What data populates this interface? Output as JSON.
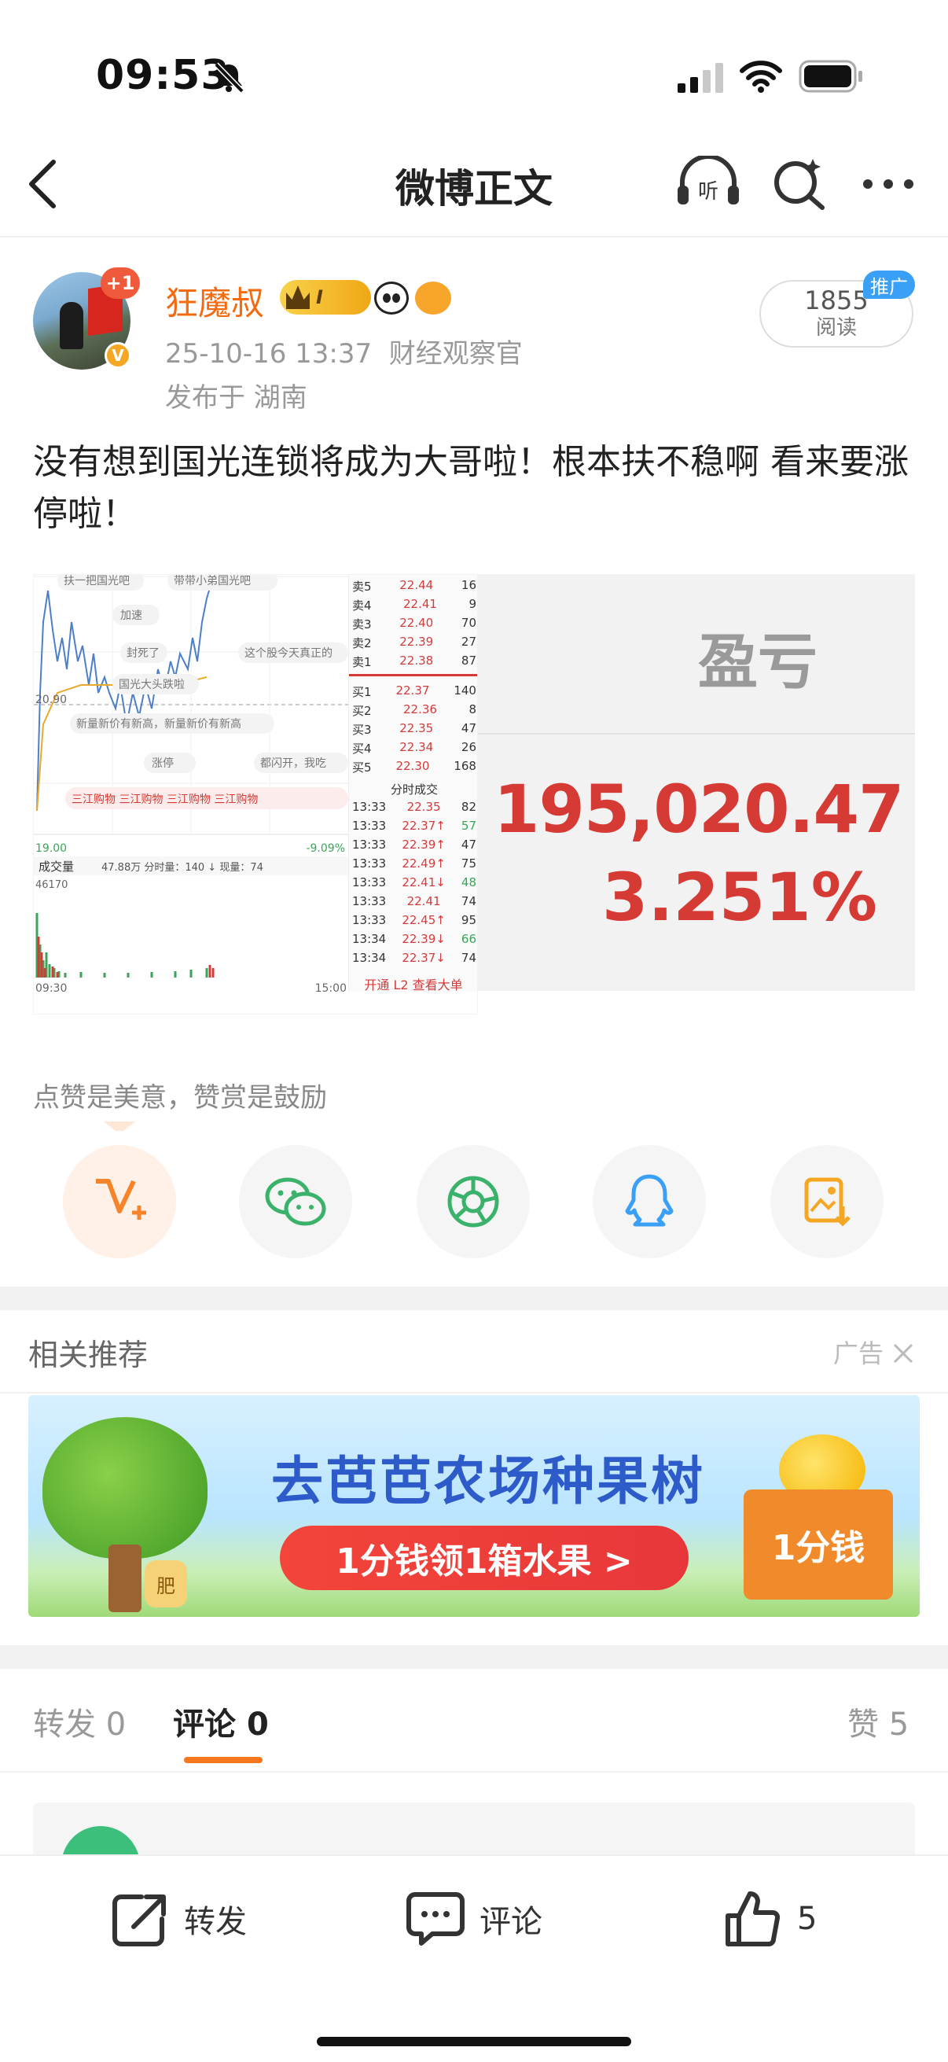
{
  "status_bar": {
    "time": "09:53"
  },
  "nav": {
    "title": "微博正文"
  },
  "post": {
    "author": "狂魔叔",
    "plus_badge": "+1",
    "level": "I",
    "date": "25-10-16 13:37",
    "source": "财经观察官",
    "location": "发布于 湖南",
    "read_count": "1855",
    "read_label": "阅读",
    "promo_tag": "推广",
    "text": "没有想到国光连锁将成为大哥啦！根本扶不稳啊 看来要涨停啦！"
  },
  "image1": {
    "labels": {
      "price_high": "20.90",
      "price_low": "19.00",
      "change": "-9.09%",
      "time_start": "09:30",
      "time_end": "15:00",
      "volume": "成交量",
      "volume_info": "47.88万 分时量：140 ↓ 现量：74",
      "vol_max": "46170",
      "l2": "开通 L2 查看大单",
      "fill": "分时成交"
    },
    "danmu": [
      "扶一把国光吧",
      "带带小弟国光吧",
      "加速",
      "封死了",
      "这个股今天真正的",
      "国光大头跌啦",
      "新量新价有新高，新量新价有新高",
      "涨停",
      "都闪开，我吃",
      "三江购物 三江购物 三江购物 三江购物"
    ],
    "asks": [
      {
        "label": "卖5",
        "price": "22.44",
        "vol": "16"
      },
      {
        "label": "卖4",
        "price": "22.41",
        "vol": "9"
      },
      {
        "label": "卖3",
        "price": "22.40",
        "vol": "70"
      },
      {
        "label": "卖2",
        "price": "22.39",
        "vol": "27"
      },
      {
        "label": "卖1",
        "price": "22.38",
        "vol": "87"
      }
    ],
    "bids": [
      {
        "label": "买1",
        "price": "22.37",
        "vol": "140"
      },
      {
        "label": "买2",
        "price": "22.36",
        "vol": "8"
      },
      {
        "label": "买3",
        "price": "22.35",
        "vol": "47"
      },
      {
        "label": "买4",
        "price": "22.34",
        "vol": "26"
      },
      {
        "label": "买5",
        "price": "22.30",
        "vol": "168"
      }
    ],
    "trades": [
      {
        "time": "13:33",
        "price": "22.35",
        "vol": "82"
      },
      {
        "time": "13:33",
        "price": "22.37↑",
        "vol": "57"
      },
      {
        "time": "13:33",
        "price": "22.39↑",
        "vol": "47"
      },
      {
        "time": "13:33",
        "price": "22.49↑",
        "vol": "75"
      },
      {
        "time": "13:33",
        "price": "22.41↓",
        "vol": "48"
      },
      {
        "time": "13:33",
        "price": "22.41",
        "vol": "74"
      },
      {
        "time": "13:33",
        "price": "22.45↑",
        "vol": "95"
      },
      {
        "time": "13:34",
        "price": "22.39↓",
        "vol": "66"
      },
      {
        "time": "13:34",
        "price": "22.37↓",
        "vol": "74"
      }
    ]
  },
  "image2": {
    "label": "盈亏",
    "amount": "195,020.47",
    "percent": "3.251%"
  },
  "cheer": {
    "text": "点赞是美意，赞赏是鼓励"
  },
  "share_icons": [
    "vplus-icon",
    "wechat-icon",
    "moments-icon",
    "qq-icon",
    "save-image-icon"
  ],
  "related": {
    "title": "相关推荐",
    "ad_label": "广告"
  },
  "ad": {
    "headline": "去芭芭农场种果树",
    "cta": "1分钱领1箱水果 >",
    "price_tag": "1分钱",
    "bag_text": "肥"
  },
  "tabs": [
    {
      "label": "转发",
      "count": "0"
    },
    {
      "label": "评论",
      "count": "0"
    },
    {
      "label": "赞",
      "count": "5"
    }
  ],
  "bottom_bar": {
    "repost": "转发",
    "comment": "评论",
    "like_count": "5"
  },
  "colors": {
    "accent": "#f5781e",
    "username": "#f46a0e",
    "stock_red": "#d53b34",
    "promo_blue": "#3aa0f5"
  }
}
